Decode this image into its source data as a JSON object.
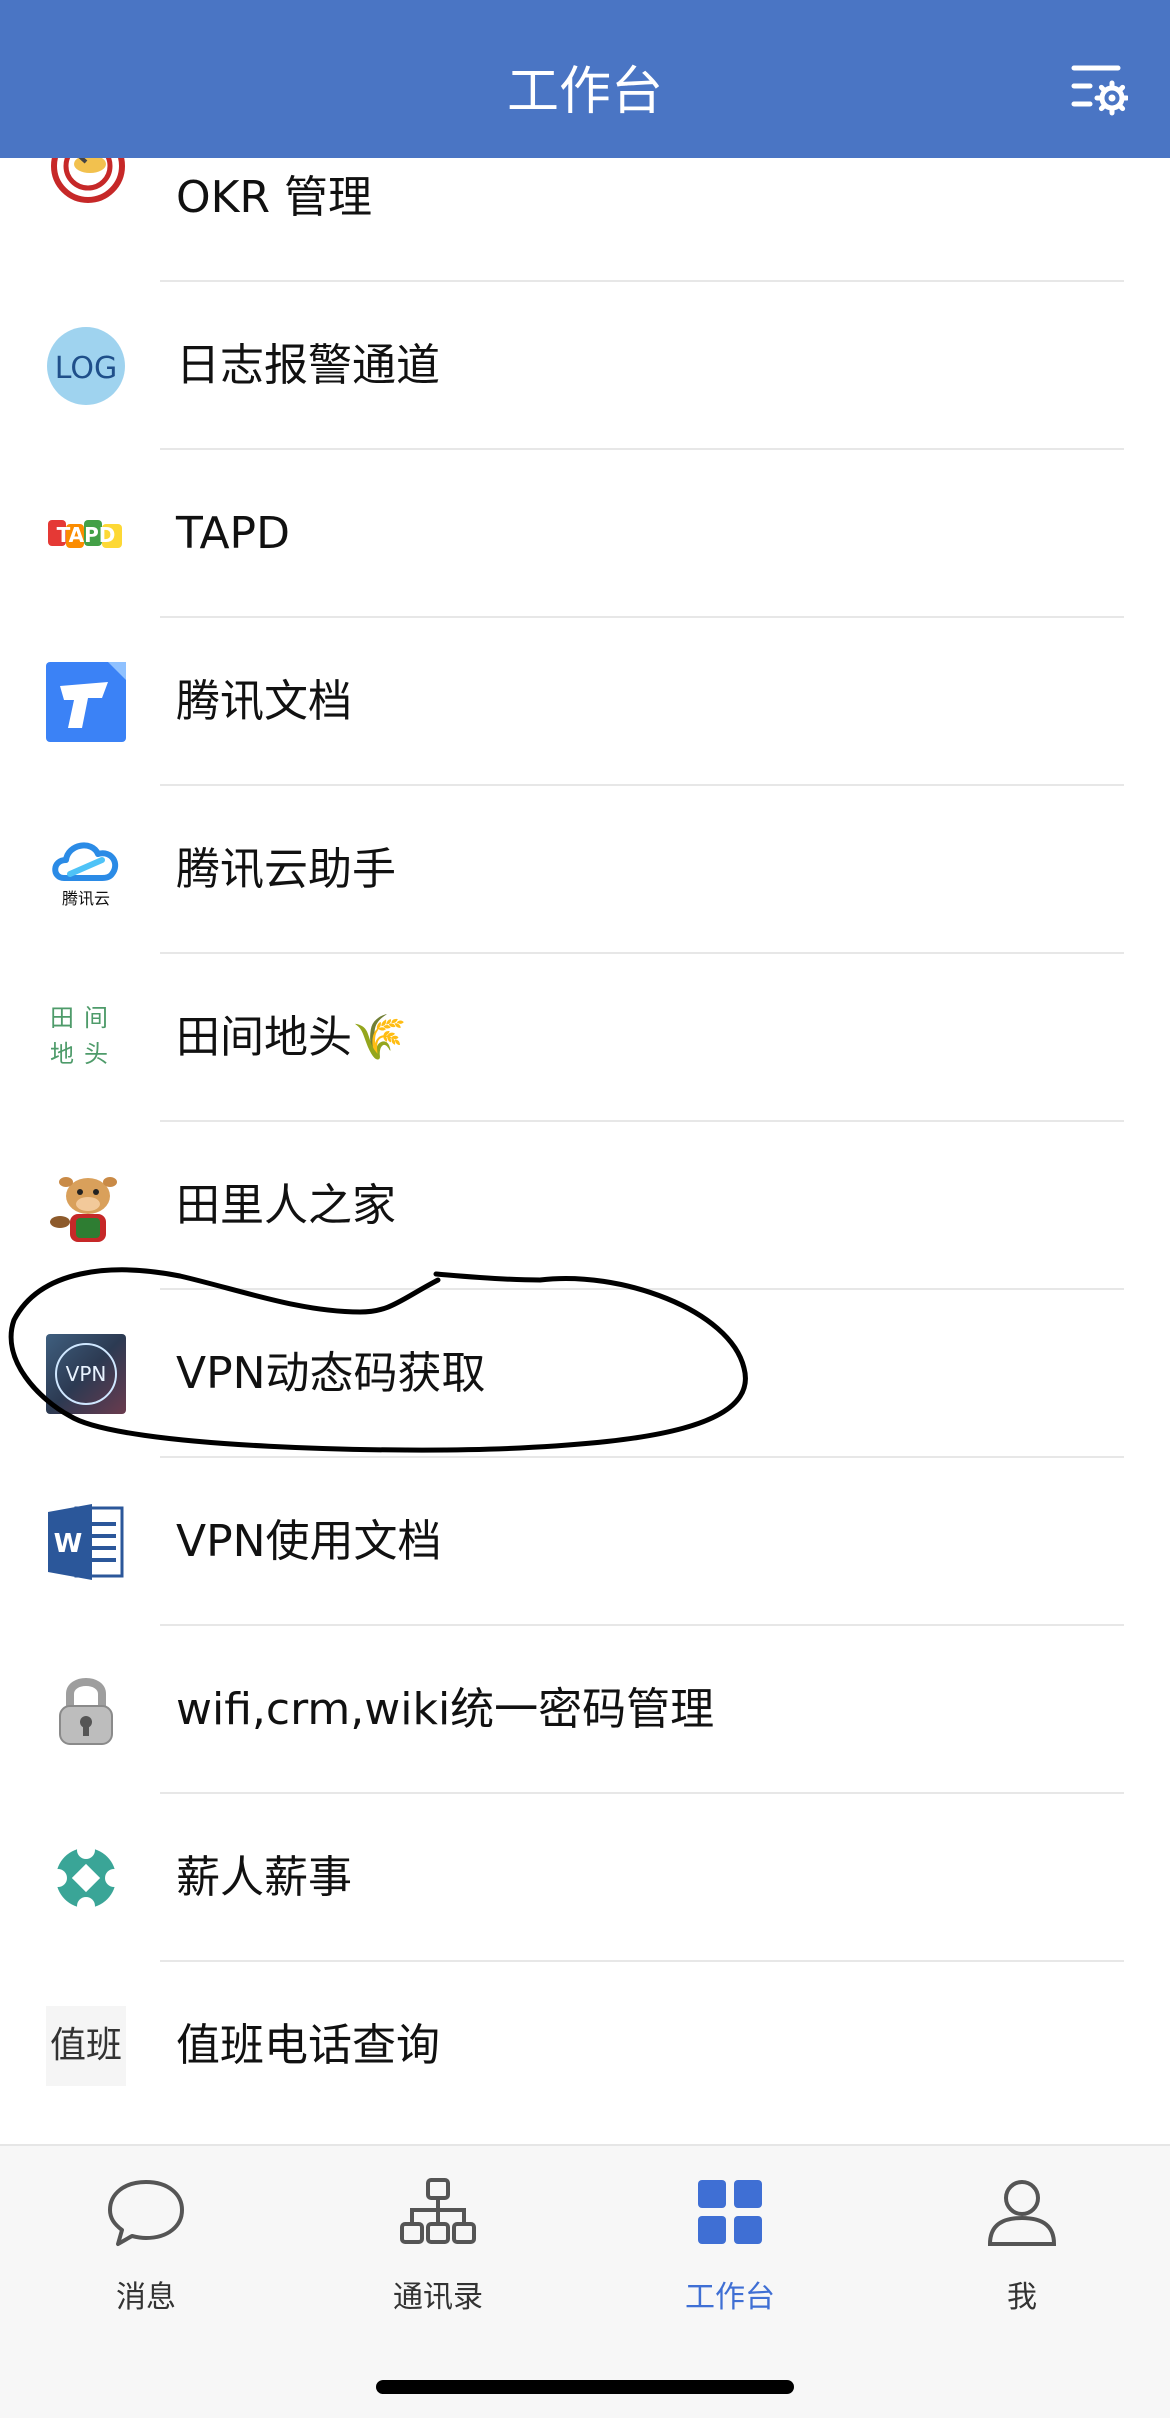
{
  "header": {
    "title": "工作台",
    "settings_icon": "list-settings-icon"
  },
  "apps": [
    {
      "label": "OKR 管理",
      "icon": "okr-target-icon"
    },
    {
      "label": "日志报警通道",
      "icon": "log-icon",
      "icon_text": "LOG"
    },
    {
      "label": "TAPD",
      "icon": "tapd-logo-icon",
      "icon_text": "TAPD"
    },
    {
      "label": "腾讯文档",
      "icon": "tencent-docs-icon"
    },
    {
      "label": "腾讯云助手",
      "icon": "tencent-cloud-icon",
      "icon_text": "腾讯云"
    },
    {
      "label": "田间地头🌾",
      "icon": "field-icon",
      "icon_text": "田间地头"
    },
    {
      "label": "田里人之家",
      "icon": "cartoon-cow-icon"
    },
    {
      "label": "VPN动态码获取",
      "icon": "vpn-icon",
      "icon_text": "VPN"
    },
    {
      "label": "VPN使用文档",
      "icon": "word-doc-icon",
      "icon_text": "W"
    },
    {
      "label": "wifi,crm,wiki统一密码管理",
      "icon": "padlock-icon"
    },
    {
      "label": "薪人薪事",
      "icon": "xinren-logo-icon"
    },
    {
      "label": "值班电话查询",
      "icon": "duty-icon",
      "icon_text": "值班"
    }
  ],
  "tabbar": {
    "tabs": [
      {
        "label": "消息",
        "icon": "chat-bubble-icon",
        "active": false
      },
      {
        "label": "通讯录",
        "icon": "org-chart-icon",
        "active": false
      },
      {
        "label": "工作台",
        "icon": "grid-icon",
        "active": true
      },
      {
        "label": "我",
        "icon": "person-icon",
        "active": false
      }
    ]
  },
  "colors": {
    "header_bg": "#4a75c4",
    "active_tab": "#3f6fd4",
    "inactive_tab": "#555555",
    "annotation_ink": "#000000"
  }
}
